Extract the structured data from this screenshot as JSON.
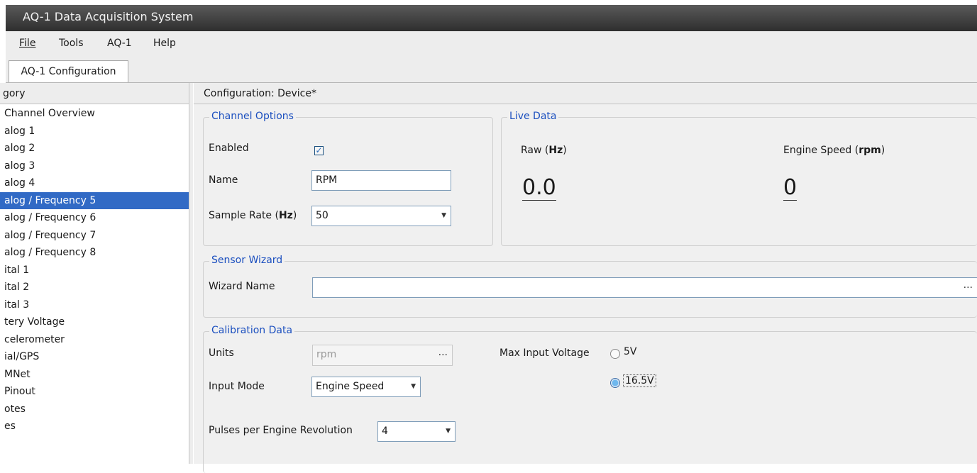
{
  "window": {
    "title": "AQ-1 Data Acquisition System"
  },
  "menu": [
    "File",
    "Tools",
    "AQ-1",
    "Help"
  ],
  "tab": {
    "label": "AQ-1 Configuration"
  },
  "category": {
    "header": "gory",
    "items": [
      "Channel Overview",
      "alog 1",
      "alog 2",
      "alog 3",
      "alog 4",
      "alog / Frequency 5",
      "alog / Frequency 6",
      "alog / Frequency 7",
      "alog / Frequency 8",
      "ital 1",
      "ital 2",
      "ital 3",
      "tery Voltage",
      "celerometer",
      "ial/GPS",
      "MNet",
      "Pinout",
      "otes",
      "es"
    ],
    "selected_index": 5,
    "selected_color": "#316ac5"
  },
  "config": {
    "header": "Configuration: Device*",
    "channel_options": {
      "legend": "Channel Options",
      "enabled_label": "Enabled",
      "enabled_checked": true,
      "name_label": "Name",
      "name_value": "RPM",
      "sample_rate_label": "Sample Rate (",
      "sample_rate_unit": "Hz",
      "sample_rate_close": ")",
      "sample_rate_value": "50"
    },
    "live_data": {
      "legend": "Live Data",
      "raw_label": "Raw (",
      "raw_unit": "Hz",
      "raw_close": ")",
      "raw_value": "0.0",
      "engine_label": "Engine Speed (",
      "engine_unit": "rpm",
      "engine_close": ")",
      "engine_value": "0"
    },
    "sensor_wizard": {
      "legend": "Sensor Wizard",
      "name_label": "Wizard Name",
      "name_value": "",
      "browse": "..."
    },
    "calibration": {
      "legend": "Calibration Data",
      "units_label": "Units",
      "units_value": "rpm",
      "units_browse": "...",
      "input_mode_label": "Input Mode",
      "input_mode_value": "Engine Speed",
      "pulses_label": "Pulses per Engine Revolution",
      "pulses_value": "4",
      "max_voltage_label": "Max Input Voltage",
      "voltage_options": [
        "5V",
        "16.5V"
      ],
      "voltage_selected": "16.5V"
    }
  },
  "colors": {
    "legend": "#1b4fbf",
    "titlebar": "#3a3a3a",
    "panel": "#f0f0f0"
  },
  "icons": {
    "dropdown": "chevron-down-icon",
    "check": "check-icon"
  }
}
